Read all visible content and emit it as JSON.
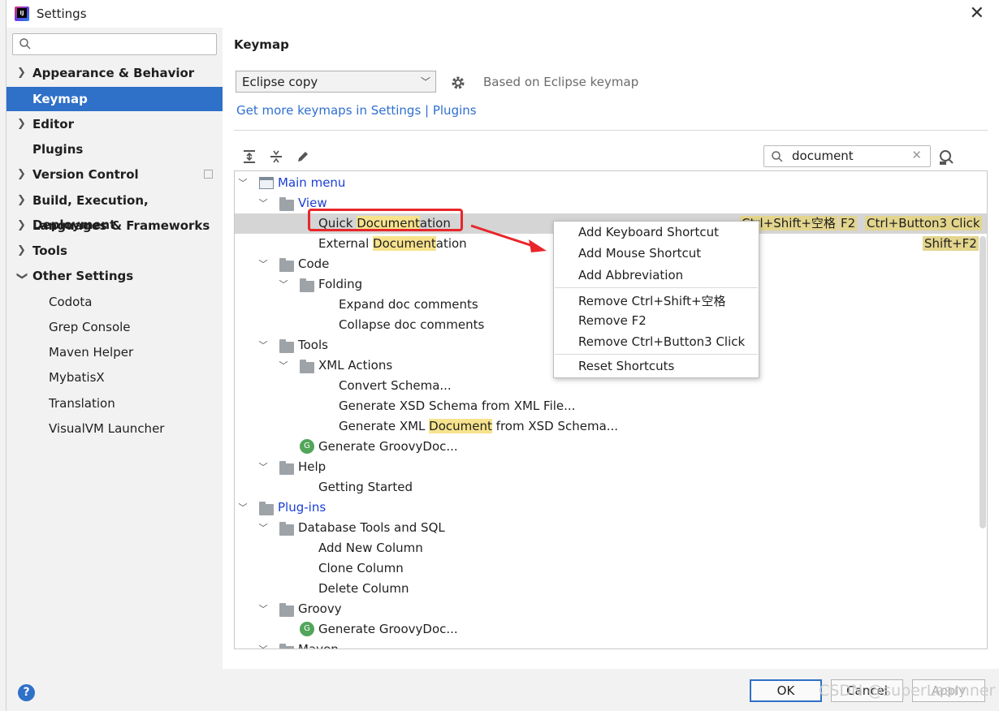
{
  "window": {
    "title": "Settings"
  },
  "sidebar": {
    "search_placeholder": "",
    "items": [
      {
        "label": "Appearance & Behavior"
      },
      {
        "label": "Keymap"
      },
      {
        "label": "Editor"
      },
      {
        "label": "Plugins"
      },
      {
        "label": "Version Control"
      },
      {
        "label": "Build, Execution, Deployment"
      },
      {
        "label": "Languages & Frameworks"
      },
      {
        "label": "Tools"
      },
      {
        "label": "Other Settings"
      },
      {
        "label": "Codota"
      },
      {
        "label": "Grep Console"
      },
      {
        "label": "Maven Helper"
      },
      {
        "label": "MybatisX"
      },
      {
        "label": "Translation"
      },
      {
        "label": "VisualVM Launcher"
      }
    ]
  },
  "keymap": {
    "heading": "Keymap",
    "selected_keymap": "Eclipse copy",
    "based_on": "Based on Eclipse keymap",
    "get_more": "Get more keymaps in Settings | Plugins",
    "search_value": "document"
  },
  "tree": {
    "main_menu": "Main menu",
    "view": "View",
    "quick_doc_pre": "Quick ",
    "quick_doc_hl": "Documen",
    "quick_doc_hl2": "t",
    "quick_doc_post": "ation",
    "ext_doc_pre": "External ",
    "ext_doc_hl": "Documen",
    "ext_doc_hl2": "t",
    "ext_doc_post": "ation",
    "code": "Code",
    "folding": "Folding",
    "expand_doc": "Expand doc comments",
    "collapse_doc": "Collapse doc comments",
    "tools": "Tools",
    "xml_actions": "XML Actions",
    "convert_schema": "Convert Schema...",
    "gen_xsd": "Generate XSD Schema from XML File...",
    "gen_xml_pre": "Generate XML ",
    "gen_xml_hl": "Document",
    "gen_xml_post": " from XSD Schema...",
    "gen_groovydoc": "Generate GroovyDoc...",
    "help": "Help",
    "getting_started": "Getting Started",
    "plugins": "Plug-ins",
    "db_tools": "Database Tools and SQL",
    "add_col": "Add New Column",
    "clone_col": "Clone Column",
    "delete_col": "Delete Column",
    "groovy": "Groovy",
    "gen_groovydoc2": "Generate GroovyDoc...",
    "maven": "Maven"
  },
  "shortcuts": {
    "quick_doc_1": "Ctrl+Shift+空格",
    "quick_doc_2": "F2",
    "quick_doc_3": "Ctrl+Button3 Click",
    "ext_doc_1": "Shift+F2"
  },
  "context_menu": {
    "add_keyboard": "Add Keyboard Shortcut",
    "add_mouse": "Add Mouse Shortcut",
    "add_abbrev": "Add Abbreviation",
    "remove_1": "Remove Ctrl+Shift+空格",
    "remove_2": "Remove F2",
    "remove_3": "Remove Ctrl+Button3 Click",
    "reset": "Reset Shortcuts"
  },
  "buttons": {
    "ok": "OK",
    "cancel": "Cancel",
    "apply": "Apply",
    "help": "?"
  },
  "watermark": "CSDN @superLearnner",
  "colors": {
    "accent": "#2f70c8",
    "highlight": "#f7e38d",
    "annotation": "#e8262a",
    "link": "#2f6fd0"
  }
}
